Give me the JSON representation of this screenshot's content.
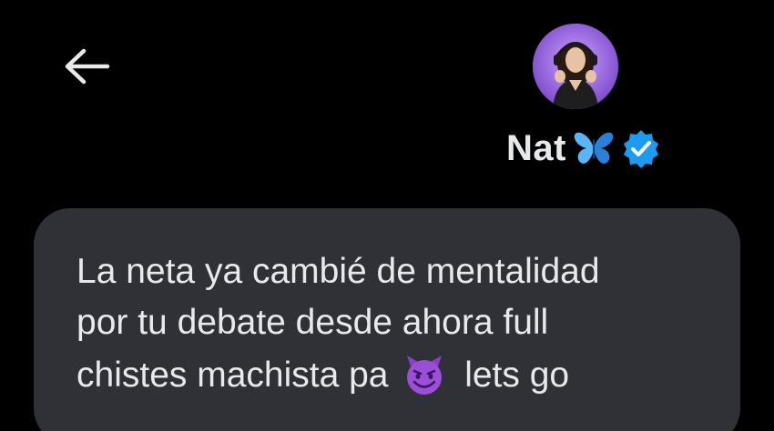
{
  "header": {
    "back_icon": "arrow-left-icon",
    "contact": {
      "name": "Nat",
      "name_emoji_icon": "butterfly-icon",
      "verified_icon": "verified-badge-icon",
      "avatar_icon": "avatar-photo"
    }
  },
  "message": {
    "lines": [
      "La neta ya cambié de mentalidad",
      "por tu debate desde ahora full",
      "chistes machista pa"
    ],
    "emoji_icon": "smiling-devil-icon",
    "after_emoji": "lets go"
  },
  "colors": {
    "background": "#000000",
    "bubble": "#2f3136",
    "text": "#e7e9ea",
    "verified": "#1d9bf0",
    "butterfly": "#5ab4f5",
    "emoji": "#9b4fd6"
  }
}
